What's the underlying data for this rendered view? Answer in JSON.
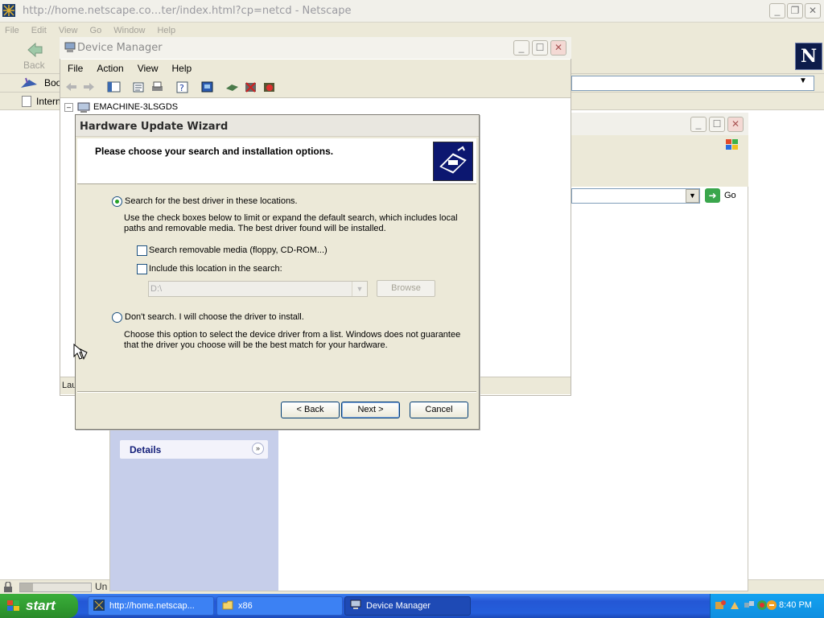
{
  "netscape": {
    "title": "http://home.netscape.co…ter/index.html?cp=netcd - Netscape",
    "menu": [
      "File",
      "Edit",
      "View",
      "Go",
      "Window",
      "Help"
    ],
    "back_label": "Back",
    "bookmarks_label": "Boo",
    "internet_label": "Intern",
    "status_text": "Un",
    "logo_letter": "N"
  },
  "explorer": {
    "go_label": "Go",
    "details_label": "Details"
  },
  "device_manager": {
    "title": "Device Manager",
    "menu": [
      "File",
      "Action",
      "View",
      "Help"
    ],
    "tree_root": "EMACHINE-3LSGDS",
    "status_text": "Lau"
  },
  "wizard": {
    "title": "Hardware Update Wizard",
    "header": "Please choose your search and installation options.",
    "option_search_label": "Search for the best driver in these locations.",
    "option_search_desc": "Use the check boxes below to limit or expand the default search, which includes local paths and removable media. The best driver found will be installed.",
    "check_removable_label": "Search removable media (floppy, CD-ROM...)",
    "check_location_label": "Include this location in the search:",
    "location_value": "D:\\",
    "browse_label": "Browse",
    "option_dont_search_label": "Don't search. I will choose the driver to install.",
    "option_dont_search_desc": "Choose this option to select the device driver from a list.  Windows does not guarantee that the driver you choose will be the best match for your hardware.",
    "back_button": "< Back",
    "next_button": "Next >",
    "cancel_button": "Cancel",
    "selected_option": "search"
  },
  "taskbar": {
    "start_label": "start",
    "tasks": [
      {
        "label": "http://home.netscap...",
        "active": false
      },
      {
        "label": "x86",
        "active": false
      },
      {
        "label": "Device Manager",
        "active": true
      }
    ],
    "clock": "8:40 PM"
  },
  "colors": {
    "taskbar_blue": "#245edb",
    "start_green": "#2f9a2f",
    "wizard_bg": "#ece9d8",
    "radio_dot": "#24a024"
  }
}
